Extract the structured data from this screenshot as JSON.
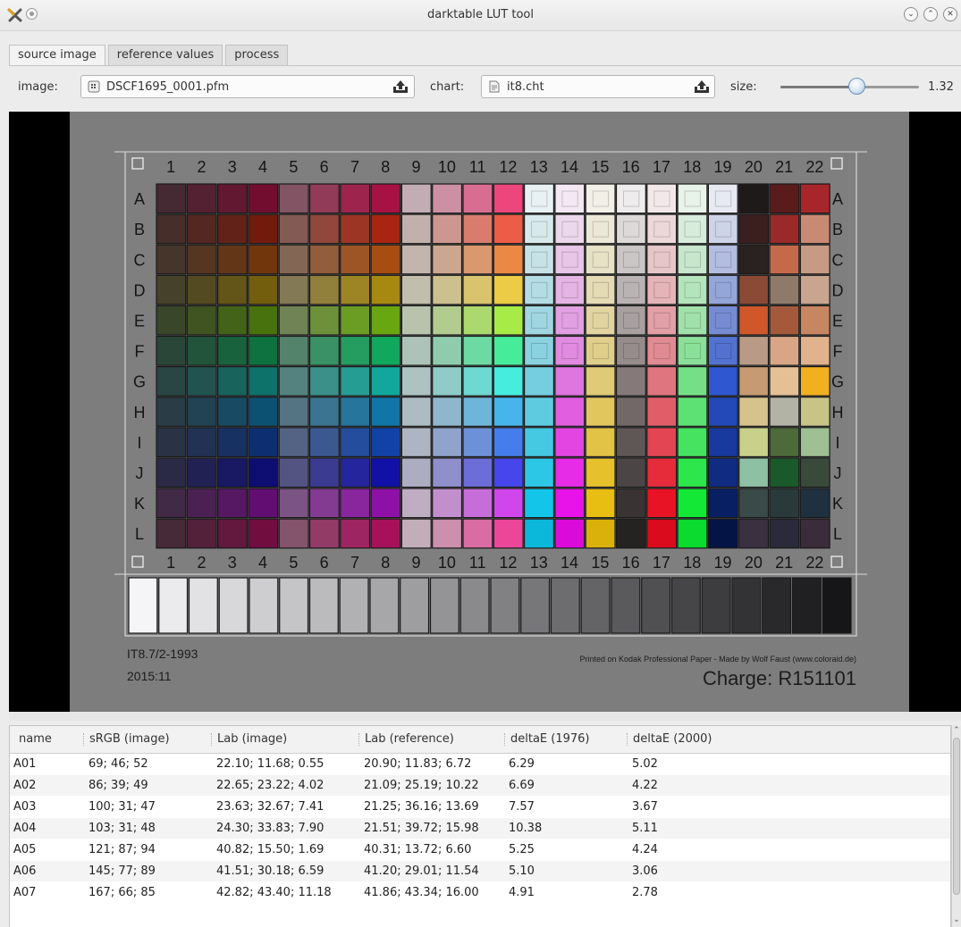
{
  "window": {
    "title": "darktable LUT tool"
  },
  "tabs": [
    {
      "label": "source image",
      "active": true
    },
    {
      "label": "reference values",
      "active": false
    },
    {
      "label": "process",
      "active": false
    }
  ],
  "toolbar": {
    "image_label": "image:",
    "image_file": "DSCF1695_0001.pfm",
    "chart_label": "chart:",
    "chart_file": "it8.cht",
    "size_label": "size:",
    "size_value": "1.32",
    "size_slider_fraction": 0.55
  },
  "chart": {
    "columns": [
      "1",
      "2",
      "3",
      "4",
      "5",
      "6",
      "7",
      "8",
      "9",
      "10",
      "11",
      "12",
      "13",
      "14",
      "15",
      "16",
      "17",
      "18",
      "19",
      "20",
      "21",
      "22"
    ],
    "rows": [
      "A",
      "B",
      "C",
      "D",
      "E",
      "F",
      "G",
      "H",
      "I",
      "J",
      "K",
      "L"
    ],
    "footer_left_1": "IT8.7/2-1993",
    "footer_left_2": "2015:11",
    "footer_right_small": "Printed on Kodak Professional Paper  -  Made by Wolf Faust (www.coloraid.de)",
    "footer_right_large": "Charge: R151101",
    "colors": {
      "canvas_bg": "#7d7d7d",
      "chart_bg": "#808080"
    }
  },
  "table": {
    "headers": [
      "name",
      "sRGB (image)",
      "Lab (image)",
      "Lab (reference)",
      "deltaE (1976)",
      "deltaE (2000)"
    ],
    "rows": [
      [
        "A01",
        "69; 46; 52",
        "22.10; 11.68; 0.55",
        "20.90; 11.83; 6.72",
        "6.29",
        "5.02"
      ],
      [
        "A02",
        "86; 39; 49",
        "22.65; 23.22; 4.02",
        "21.09; 25.19; 10.22",
        "6.69",
        "4.22"
      ],
      [
        "A03",
        "100; 31; 47",
        "23.63; 32.67; 7.41",
        "21.25; 36.16; 13.69",
        "7.57",
        "3.67"
      ],
      [
        "A04",
        "103; 31; 48",
        "24.30; 33.83; 7.90",
        "21.51; 39.72; 15.98",
        "10.38",
        "5.11"
      ],
      [
        "A05",
        "121; 87; 94",
        "40.82; 15.50; 1.69",
        "40.31; 13.72; 6.60",
        "5.25",
        "4.24"
      ],
      [
        "A06",
        "145; 77; 89",
        "41.51; 30.18; 6.59",
        "41.20; 29.01; 11.54",
        "5.10",
        "3.06"
      ],
      [
        "A07",
        "167; 66; 85",
        "42.82; 43.40; 11.18",
        "41.86; 43.34; 16.00",
        "4.91",
        "2.78"
      ]
    ]
  }
}
